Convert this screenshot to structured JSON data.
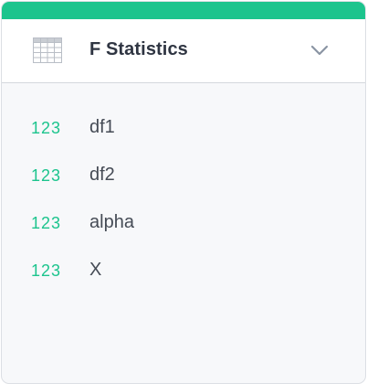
{
  "panel": {
    "title": "F Statistics",
    "icon": "table-icon",
    "accent_color": "#1cc48d"
  },
  "fields": [
    {
      "type_label": "123",
      "name": "df1"
    },
    {
      "type_label": "123",
      "name": "df2"
    },
    {
      "type_label": "123",
      "name": "alpha"
    },
    {
      "type_label": "123",
      "name": "X"
    }
  ]
}
